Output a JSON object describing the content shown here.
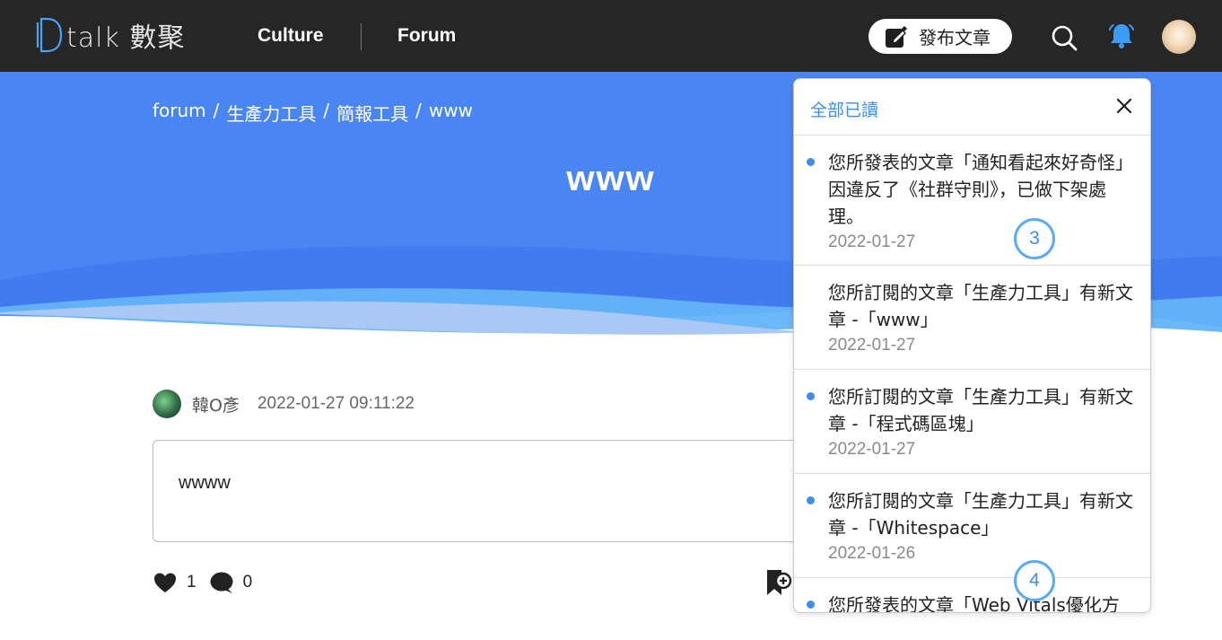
{
  "header": {
    "logo_text": "talk 數聚",
    "nav": [
      "Culture",
      "Forum"
    ],
    "publish_label": "發布文章"
  },
  "breadcrumb": [
    "forum",
    "生產力工具",
    "簡報工具",
    "www"
  ],
  "breadcrumb_sep": "/",
  "post": {
    "title": "www",
    "author": "韓O彥",
    "time": "2022-01-27 09:11:22",
    "body": "wwww",
    "likes": "1",
    "comments": "0"
  },
  "notifications": {
    "mark_all_label": "全部已讀",
    "items": [
      {
        "text": "您所發表的文章「通知看起來好奇怪」因違反了《社群守則》，已做下架處理。",
        "date": "2022-01-27",
        "unread": true,
        "badge": "3"
      },
      {
        "text": "您所訂閱的文章「生產力工具」有新文章 -「www」",
        "date": "2022-01-27",
        "unread": false,
        "badge": ""
      },
      {
        "text": "您所訂閱的文章「生產力工具」有新文章 -「程式碼區塊」",
        "date": "2022-01-27",
        "unread": true,
        "badge": ""
      },
      {
        "text": "您所訂閱的文章「生產力工具」有新文章 -「Whitespace」",
        "date": "2022-01-26",
        "unread": true,
        "badge": "4"
      },
      {
        "text": "您所發表的文章「Web Vitals優化方",
        "date": "",
        "unread": true,
        "badge": ""
      }
    ]
  },
  "colors": {
    "topbar": "#262626",
    "hero_blue": "#4a86f3",
    "accent": "#3b8ef0"
  }
}
